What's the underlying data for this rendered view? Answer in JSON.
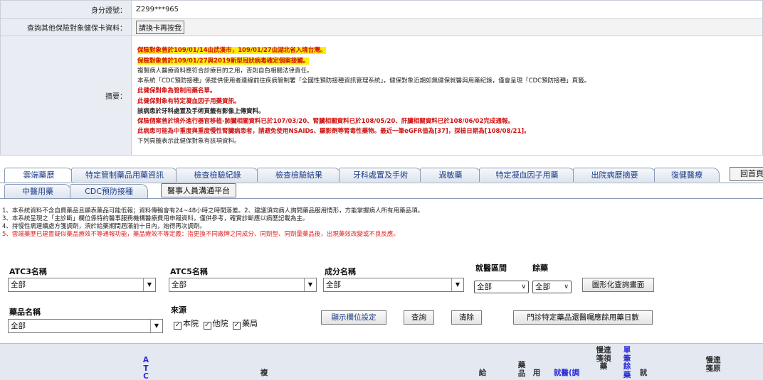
{
  "patient": {
    "id_label": "身分證號：",
    "id_value": "Z299***965",
    "other_label": "查詢其他保險對象健保卡資料：",
    "swap_card_button": "請換卡再按我",
    "summary_label": "摘要："
  },
  "summary_lines": [
    {
      "style": "hl",
      "text": "保險對象曾於109/01/14由武漢市，109/01/27由湖北省入境台灣。"
    },
    {
      "style": "hl",
      "text": "保險對象曾於109/01/27與2019新型冠狀病毒確定個案接觸。"
    },
    {
      "style": "black",
      "text": "複製病人醫療資料應符合診療目的之用，否則自負相關法律責任。"
    },
    {
      "style": "black",
      "text": "本系統「CDC預防接種」係提供使用者連線前往疾病管制署「全國性預防接種資訊管理系統」，健保對象近期如無健保就醫與用藥紀錄，僅會呈現「CDC預防接種」頁籤。"
    },
    {
      "style": "red",
      "text": "此健保對象為管制用藥名單。"
    },
    {
      "style": "red",
      "text": "此健保對象有特定凝血因子用藥資訊。"
    },
    {
      "style": "bold",
      "text": "該病患於牙科處置及手術頁籤有影像上傳資料。"
    },
    {
      "style": "red",
      "text": "保險個案曾於境外進行器官移植-肺臟相關資料已於107/03/20、腎臟相關資料已於108/05/20、肝臟相關資料已於108/06/02完成通報。"
    },
    {
      "style": "red",
      "text": "此病患可能為中重度與重度慢性腎臟病患者，請避免使用NSAIDs、顯影劑等腎毒性藥物。最近一筆eGFR值為[37]，採檢日期為[108/08/21]。"
    },
    {
      "style": "black",
      "text": "下列頁籤表示此健保對象有該項資料。"
    }
  ],
  "tabs_row1": [
    "雲端藥歷",
    "特定管制藥品用藥資訊",
    "檢查檢驗紀錄",
    "檢查檢驗結果",
    "牙科處置及手術",
    "過敏藥",
    "特定凝血因子用藥",
    "出院病歷摘要",
    "復健醫療"
  ],
  "home_button": "回首頁",
  "tabs_row2": [
    "中醫用藥",
    "CDC預防接種",
    "醫事人員溝通平台"
  ],
  "notes": [
    "1、本系統資料不含自費藥品且顯表藥品可能低報；資料傳輸會有24~48小時之時間落差。2、建議須向病人詢問藥品服用情形，方能掌握病人所有用藥品項。",
    "3、本系統呈現之「主診斷」欄位係特約醫事服務機構醫療費用申報資料，僅供參考，確實診斷應以病歷記載為主。",
    "4、持慢性病連續處方箋調劑，須於給藥期間屆滿前十日內，始得再次調劑。",
    "5、雲端藥歷已建置疑似藥品療效不等通報功能，藥品療效不等定義：指更換不同廠牌之同成分、同劑型、同劑量藥品後，出現藥效改變或不良反應。"
  ],
  "filters": {
    "atc3_label": "ATC3名稱",
    "atc3_value": "全部",
    "atc5_label": "ATC5名稱",
    "atc5_value": "全部",
    "ingredient_label": "成分名稱",
    "ingredient_value": "全部",
    "period_label": "就醫區間",
    "period_value": "全部",
    "remaining_label": "餘藥",
    "remaining_value": "全部",
    "graph_button": "圖形化查詢畫面",
    "drug_label": "藥品名稱",
    "drug_value": "全部",
    "source_label": "來源",
    "source_options": [
      "本院",
      "他院",
      "藥局"
    ],
    "display_columns_button": "顯示欄位設定",
    "query_button": "查詢",
    "clear_button": "清除",
    "outpatient_button": "門診特定藥品還醫囑應餘用藥日數"
  },
  "grid_headers": {
    "atc": "ATC",
    "copy": "複",
    "dispense": "給",
    "drug": "藥品",
    "usage": "用",
    "visit_date": "就醫(調",
    "chronic_dispense": "慢連箋領藥",
    "single_remaining": "單筆餘藥",
    "visit": "就",
    "chronic_original": "慢連箋原"
  },
  "colors": {
    "highlight": "#ffee00",
    "alert_red": "#d01010",
    "tab_text": "#1b3d8a",
    "header_blue": "#2b2bd6",
    "label_bg": "#e9edf3"
  }
}
